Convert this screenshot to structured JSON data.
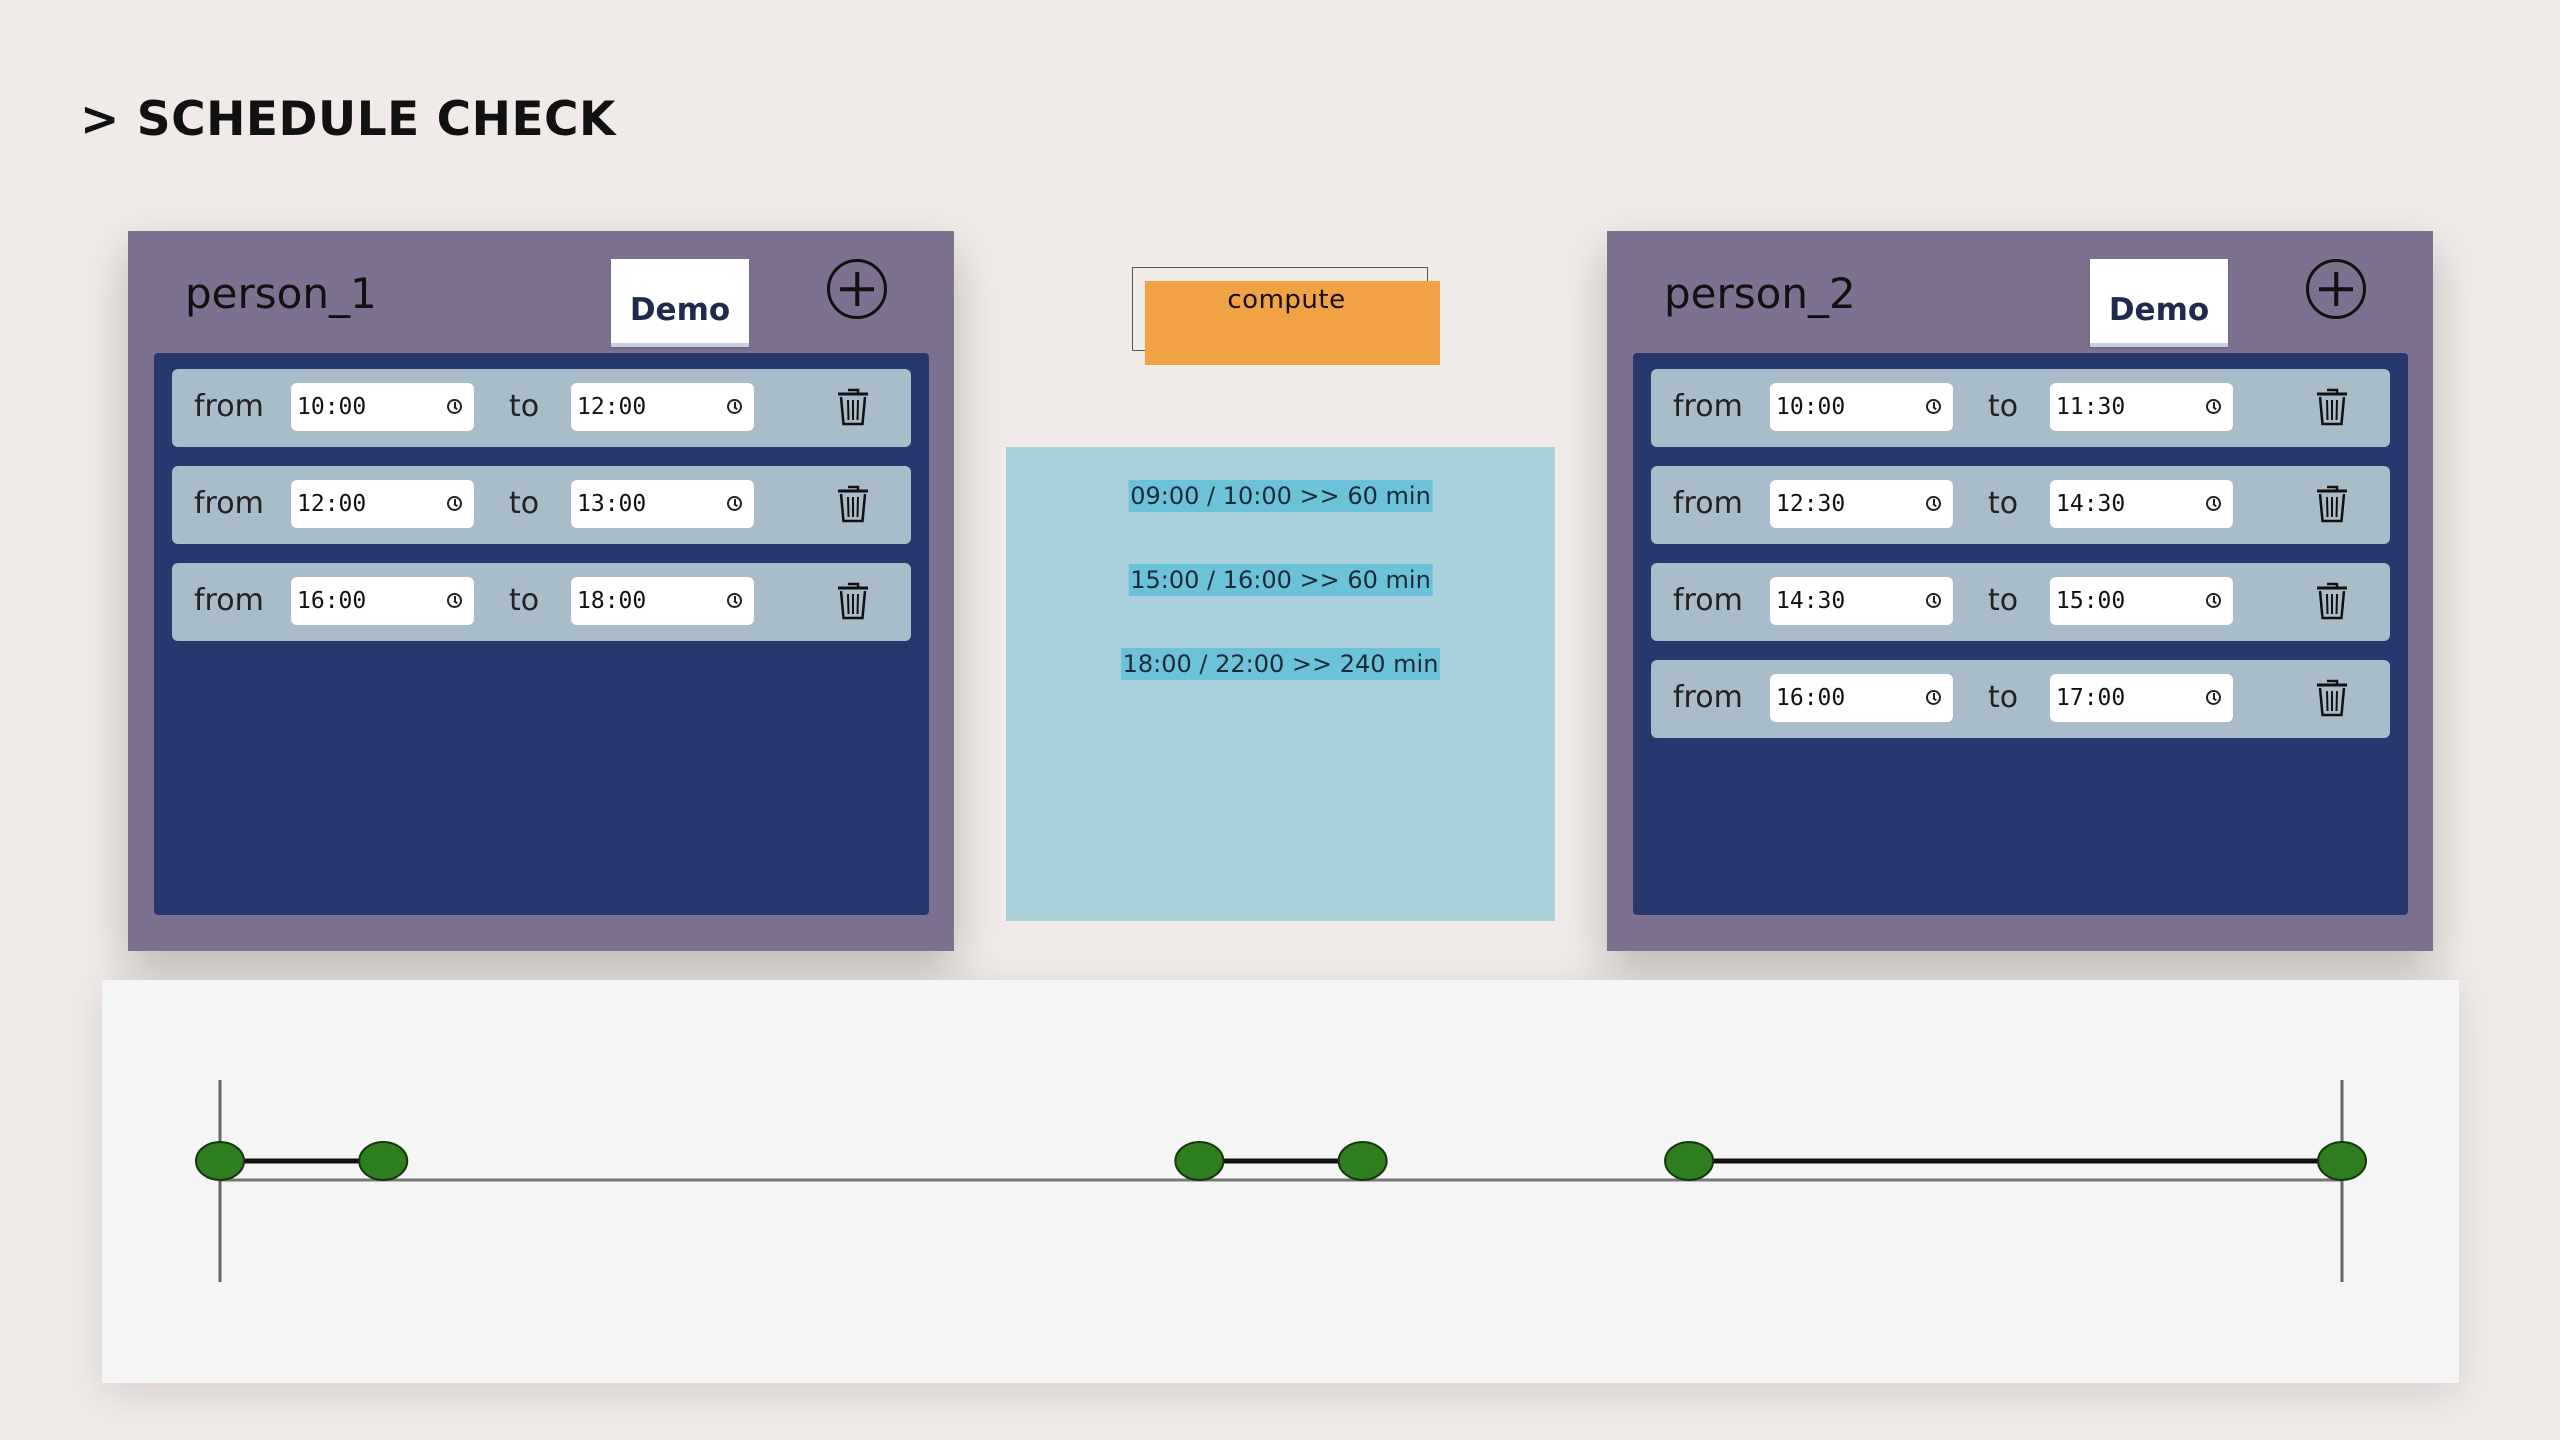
{
  "header": {
    "title": "> SCHEDULE CHECK"
  },
  "persons": [
    {
      "name": "person_1",
      "demo_label": "Demo",
      "from_label": "from",
      "to_label": "to",
      "slots": [
        {
          "from": "10:00",
          "to": "12:00"
        },
        {
          "from": "12:00",
          "to": "13:00"
        },
        {
          "from": "16:00",
          "to": "18:00"
        }
      ]
    },
    {
      "name": "person_2",
      "demo_label": "Demo",
      "from_label": "from",
      "to_label": "to",
      "slots": [
        {
          "from": "10:00",
          "to": "11:30"
        },
        {
          "from": "12:30",
          "to": "14:30"
        },
        {
          "from": "14:30",
          "to": "15:00"
        },
        {
          "from": "16:00",
          "to": "17:00"
        }
      ]
    }
  ],
  "compute": {
    "label": "compute"
  },
  "results": [
    "09:00 / 10:00 >> 60 min",
    "15:00 / 16:00 >> 60 min",
    "18:00 / 22:00 >> 240 min"
  ],
  "timeline": {
    "day_start": "09:00",
    "day_end": "22:00",
    "free_segments": [
      {
        "start": "09:00",
        "end": "10:00"
      },
      {
        "start": "15:00",
        "end": "16:00"
      },
      {
        "start": "18:00",
        "end": "22:00"
      }
    ],
    "marker_color": "#2e7d1f"
  },
  "icons": {
    "add": "plus-circle-icon",
    "delete": "trash-icon",
    "clock": "clock-icon"
  }
}
